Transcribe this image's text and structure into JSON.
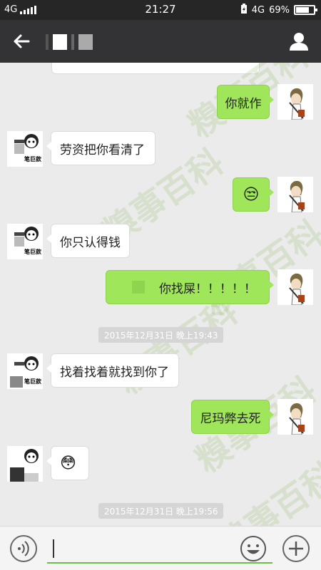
{
  "status_bar": {
    "network_left": "4G",
    "time": "21:27",
    "network_right": "4G",
    "battery": "69%",
    "battery_level": 0.69
  },
  "header": {
    "back_icon": "arrow-left-icon",
    "profile_icon": "person-icon"
  },
  "messages": [
    {
      "side": "out",
      "text": "你就作"
    },
    {
      "side": "in",
      "text": "劳资把你看清了"
    },
    {
      "side": "out",
      "text": "😒"
    },
    {
      "side": "in",
      "text": "你只认得钱"
    },
    {
      "side": "out",
      "text": "你找屎！！！！！"
    },
    {
      "side": "in",
      "text": "找着找着就找到你了"
    },
    {
      "side": "out",
      "text": "尼玛弊去死"
    },
    {
      "side": "in",
      "text": "😳"
    }
  ],
  "timestamps": [
    "2015年12月31日 晚上19:43",
    "2015年12月31日 晚上19:56"
  ],
  "avatar_sticker_text": "笔巨款",
  "watermark_text": "糗事百科",
  "colors": {
    "outgoing_bubble": "#9fe65a",
    "header_bg": "#333335",
    "input_underline": "#6cc04a"
  },
  "input": {
    "value": "",
    "voice_icon": "voice-icon",
    "emoji_icon": "emoji-smiley-icon",
    "plus_icon": "plus-icon"
  }
}
